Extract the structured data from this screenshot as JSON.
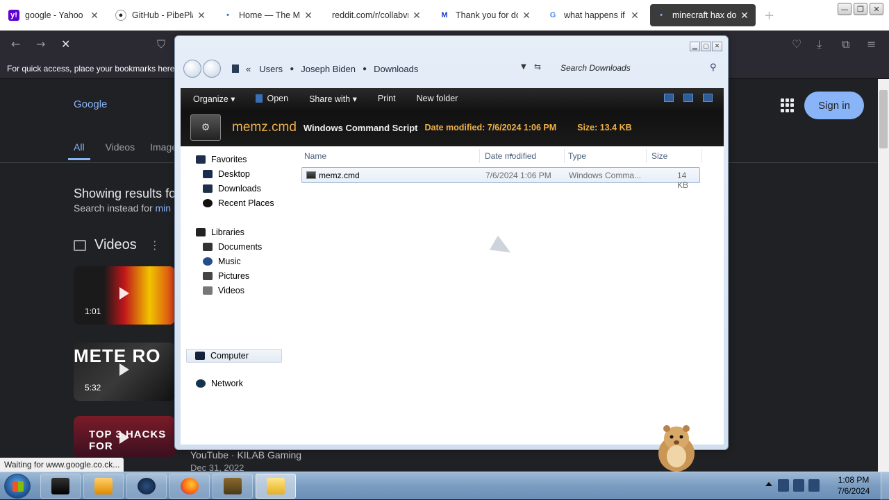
{
  "browser": {
    "tabs": [
      {
        "title": "google - Yahoo Se",
        "favicon": "yahoo-icon",
        "color": "#6001d2",
        "glyph": "y!"
      },
      {
        "title": "GitHub - PibePlay",
        "favicon": "github-icon",
        "color": "#ffffff",
        "glyph": "●"
      },
      {
        "title": "Home — The Me",
        "favicon": "dot-icon",
        "color": "#ffffff",
        "glyph": "•"
      },
      {
        "title": "reddit.com/r/collabvn",
        "favicon": "none",
        "color": "#ffffff",
        "glyph": ""
      },
      {
        "title": "Thank you for dow",
        "favicon": "malwarebytes-icon",
        "color": "#1a3bd1",
        "glyph": "M"
      },
      {
        "title": "what happens if y",
        "favicon": "google-icon",
        "color": "#ffffff",
        "glyph": "G"
      },
      {
        "title": "minecraft hax dow",
        "favicon": "dot-icon",
        "color": "#3b3b3b",
        "glyph": "•"
      }
    ],
    "bookmarks_hint": "For quick access, place your bookmarks here o",
    "status_text": "Waiting for www.google.co.ck..."
  },
  "google": {
    "logo": "Google",
    "tabs": [
      "All",
      "Videos",
      "Image"
    ],
    "showing": "Showing results fo",
    "instead_prefix": "Search instead for ",
    "instead_link": "min",
    "videos_heading": "Videos",
    "thumbs": [
      {
        "duration": "1:01",
        "overlay": ""
      },
      {
        "duration": "5:32",
        "overlay": "METE RO"
      },
      {
        "duration": "",
        "overlay": "TOP 3 HACKS FOR"
      }
    ],
    "yt_source": "YouTube · KILAB Gaming",
    "yt_date": "Dec 31, 2022",
    "sign_in": "Sign in"
  },
  "explorer": {
    "breadcrumbs": [
      "Users",
      "Joseph Biden",
      "Downloads"
    ],
    "search_placeholder": "Search Downloads",
    "toolbar": [
      "Organize ▾",
      "Open",
      "Share with ▾",
      "Print",
      "New folder"
    ],
    "details": {
      "name": "memz.cmd",
      "type": "Windows Command Script",
      "modified": "Date modified: 7/6/2024 1:06 PM",
      "size": "Size: 13.4 KB"
    },
    "nav": {
      "favorites": "Favorites",
      "desktop": "Desktop",
      "downloads": "Downloads",
      "recent": "Recent Places",
      "libraries": "Libraries",
      "documents": "Documents",
      "music": "Music",
      "pictures": "Pictures",
      "videos": "Videos",
      "computer": "Computer",
      "network": "Network"
    },
    "columns": {
      "name": "Name",
      "date": "Date modified",
      "type": "Type",
      "size": "Size"
    },
    "files": [
      {
        "name": "memz.cmd",
        "date": "7/6/2024 1:06 PM",
        "type": "Windows Comma...",
        "size": "14 KB"
      }
    ]
  },
  "taskbar": {
    "time": "1:08 PM",
    "date": "7/6/2024"
  }
}
